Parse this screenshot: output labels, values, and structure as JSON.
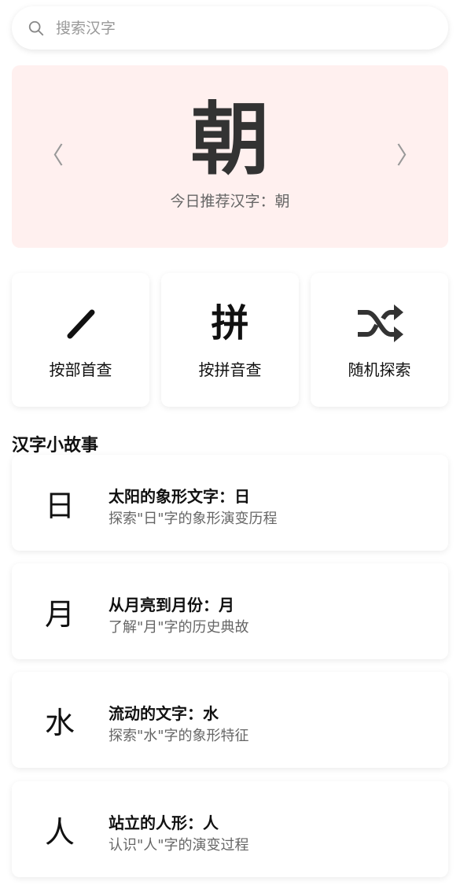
{
  "search": {
    "placeholder": "搜索汉字",
    "icon": "search-icon"
  },
  "featured": {
    "character": "朝",
    "caption": "今日推荐汉字：朝",
    "prev_arrow": "〈",
    "next_arrow": "〉",
    "background_color": "#fff0ef"
  },
  "quick_actions": [
    {
      "label": "按部首查",
      "icon": "radical-stroke-icon"
    },
    {
      "label": "按拼音查",
      "icon_text": "拼",
      "icon": "pinyin-icon"
    },
    {
      "label": "随机探索",
      "icon": "shuffle-icon"
    }
  ],
  "stories": {
    "section_title": "汉字小故事",
    "items": [
      {
        "char": "日",
        "title": "太阳的象形文字：日",
        "desc": "探索\"日\"字的象形演变历程"
      },
      {
        "char": "月",
        "title": "从月亮到月份：月",
        "desc": "了解\"月\"字的历史典故"
      },
      {
        "char": "水",
        "title": "流动的文字：水",
        "desc": "探索\"水\"字的象形特征"
      },
      {
        "char": "人",
        "title": "站立的人形：人",
        "desc": "认识\"人\"字的演变过程"
      }
    ]
  }
}
